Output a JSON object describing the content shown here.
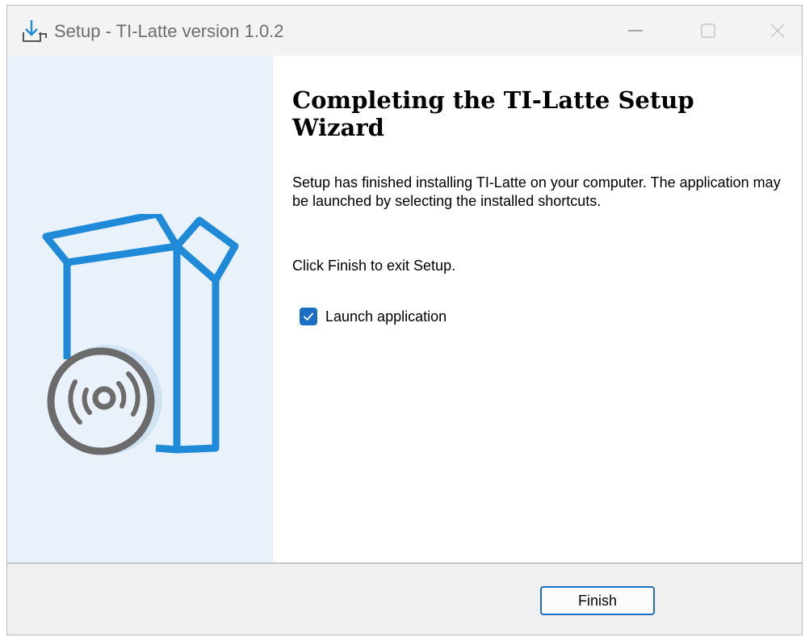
{
  "window": {
    "title": "Setup - TI-Latte version 1.0.2",
    "icon": "installer-download-icon",
    "controls": [
      "minimize-icon",
      "maximize-icon",
      "close-icon"
    ]
  },
  "banner": {
    "image": "box-with-disc-illustration",
    "accent_color": "#1f8ad8",
    "background_color": "#e9f2fa"
  },
  "content": {
    "heading": "Completing the TI-Latte Setup Wizard",
    "message": "Setup has finished installing TI-Latte on your computer. The application may be launched by selecting the installed shortcuts.",
    "instruction": "Click Finish to exit Setup.",
    "launch_checkbox": {
      "label": "Launch application",
      "checked": true
    }
  },
  "footer": {
    "finish_label": "Finish"
  }
}
